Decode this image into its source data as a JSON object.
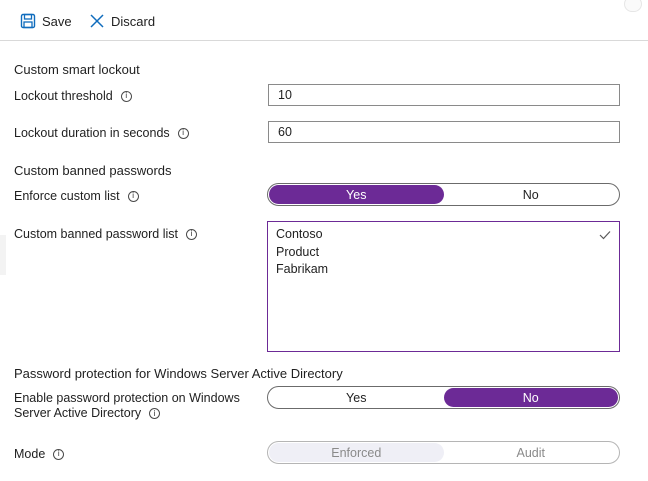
{
  "toolbar": {
    "save_label": "Save",
    "discard_label": "Discard"
  },
  "smart_lockout": {
    "section_title": "Custom smart lockout",
    "threshold_label": "Lockout threshold",
    "threshold_value": "10",
    "duration_label": "Lockout duration in seconds",
    "duration_value": "60"
  },
  "banned_passwords": {
    "section_title": "Custom banned passwords",
    "enforce_label": "Enforce custom list",
    "enforce_options": [
      "Yes",
      "No"
    ],
    "enforce_selected": "Yes",
    "list_label": "Custom banned password list",
    "list_items": [
      "Contoso",
      "Product",
      "Fabrikam"
    ]
  },
  "windows_protection": {
    "section_title": "Password protection for Windows Server Active Directory",
    "enable_label_line1": "Enable password protection on Windows",
    "enable_label_line2": "Server Active Directory",
    "enable_options": [
      "Yes",
      "No"
    ],
    "enable_selected": "No",
    "mode_label": "Mode",
    "mode_options": [
      "Enforced",
      "Audit"
    ],
    "mode_selected": "Enforced"
  },
  "icons": {
    "save": "save-icon",
    "discard": "close-icon",
    "info": "info-icon",
    "check": "check-icon"
  },
  "colors": {
    "accent": "#6c2a96",
    "toolbar_icon": "#0f6cbd"
  }
}
